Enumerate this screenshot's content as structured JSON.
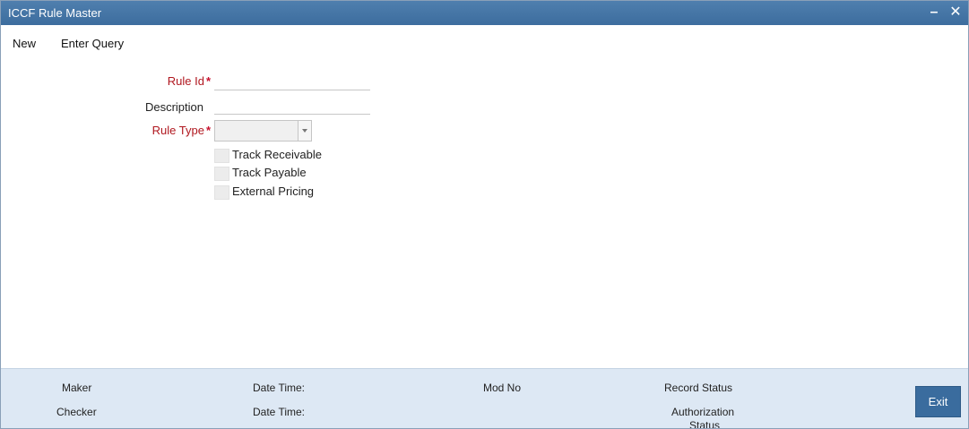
{
  "window": {
    "title": "ICCF Rule Master",
    "minimize_glyph": "–",
    "close_glyph": "✕"
  },
  "menu": {
    "items": [
      "New",
      "Enter Query"
    ]
  },
  "form": {
    "rule_id": {
      "label": "Rule Id",
      "required_mark": "*",
      "value": ""
    },
    "description": {
      "label": "Description",
      "value": ""
    },
    "rule_type": {
      "label": "Rule Type",
      "required_mark": "*",
      "selected": ""
    },
    "checkboxes": [
      {
        "label": "Track Receivable",
        "checked": false
      },
      {
        "label": "Track Payable",
        "checked": false
      },
      {
        "label": "External Pricing",
        "checked": false
      }
    ]
  },
  "footer": {
    "maker": "Maker",
    "checker": "Checker",
    "date_time_1": "Date Time:",
    "date_time_2": "Date Time:",
    "mod_no": "Mod No",
    "record_status": "Record Status",
    "authorization_status_line1": "Authorization",
    "authorization_status_line2": "Status",
    "exit_label": "Exit"
  },
  "colors": {
    "titlebar": "#3d6d9e",
    "footer": "#dde8f4",
    "required": "#b0171f",
    "exit_button": "#3a6c9e"
  }
}
